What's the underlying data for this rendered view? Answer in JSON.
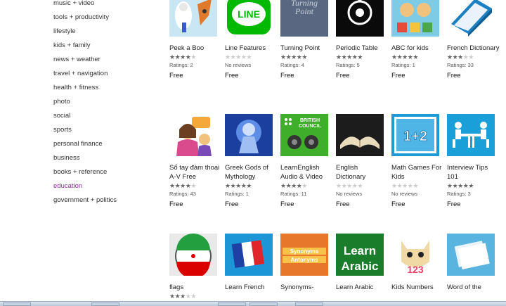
{
  "sidebar": {
    "categories": [
      {
        "label": "music + video"
      },
      {
        "label": "tools + productivity"
      },
      {
        "label": "lifestyle"
      },
      {
        "label": "kids + family"
      },
      {
        "label": "news + weather"
      },
      {
        "label": "travel + navigation"
      },
      {
        "label": "health + fitness"
      },
      {
        "label": "photo"
      },
      {
        "label": "social"
      },
      {
        "label": "sports"
      },
      {
        "label": "personal finance"
      },
      {
        "label": "business"
      },
      {
        "label": "books + reference"
      },
      {
        "label": "education",
        "active": true
      },
      {
        "label": "government + politics"
      }
    ]
  },
  "apps": [
    {
      "name": "Peek a Boo",
      "rating": 4.5,
      "ratings_text": "Ratings: 2",
      "price": "Free",
      "icon": "peekaboo-icon"
    },
    {
      "name": "Line Features",
      "rating": 0,
      "ratings_text": "No reviews",
      "price": "Free",
      "icon": "line-icon",
      "icon_text": "LINE"
    },
    {
      "name": "Turning Point",
      "rating": 5,
      "ratings_text": "Ratings: 4",
      "price": "Free",
      "icon": "turning-point-icon",
      "icon_text": "Turning Point"
    },
    {
      "name": "Periodic Table",
      "rating": 5,
      "ratings_text": "Ratings: 5",
      "price": "Free",
      "icon": "periodic-table-icon"
    },
    {
      "name": "ABC for kids",
      "rating": 5,
      "ratings_text": "Ratings: 1",
      "price": "Free",
      "icon": "abc-kids-icon"
    },
    {
      "name": "French Dictionary",
      "rating": 3,
      "ratings_text": "Ratings: 33",
      "price": "Free",
      "icon": "french-dictionary-icon"
    },
    {
      "name": "Sổ tay đàm thoại A-V Free",
      "rating": 4.5,
      "ratings_text": "Ratings: 43",
      "price": "Free",
      "icon": "so-tay-icon"
    },
    {
      "name": "Greek Gods of Mythology",
      "rating": 5,
      "ratings_text": "Ratings: 1",
      "price": "Free",
      "icon": "greek-gods-icon"
    },
    {
      "name": "LearnEnglish Audio & Video",
      "rating": 4.5,
      "ratings_text": "Ratings: 11",
      "price": "Free",
      "icon": "british-council-icon",
      "icon_text": "BRITISH COUNCIL"
    },
    {
      "name": "English Dictionary",
      "rating": 0,
      "ratings_text": "No reviews",
      "price": "Free",
      "icon": "english-dictionary-icon"
    },
    {
      "name": "Math Games For Kids",
      "rating": 0,
      "ratings_text": "No reviews",
      "price": "Free",
      "icon": "math-games-icon",
      "icon_text": "1+2"
    },
    {
      "name": "Interview Tips 101",
      "rating": 5,
      "ratings_text": "Ratings: 3",
      "price": "Free",
      "icon": "interview-tips-icon"
    },
    {
      "name": "flags",
      "rating": 3,
      "icon": "iran-flag-icon"
    },
    {
      "name": "Learn French",
      "icon": "french-flag-icon"
    },
    {
      "name": "Synonyms-",
      "icon": "synonyms-antonyms-icon",
      "icon_text_1": "Synonyms",
      "icon_text_2": "Antonyms"
    },
    {
      "name": "Learn Arabic",
      "icon": "learn-arabic-icon",
      "icon_text_1": "Learn",
      "icon_text_2": "Arabic"
    },
    {
      "name": "Kids Numbers",
      "icon": "kids-numbers-icon",
      "icon_text": "123"
    },
    {
      "name": "Word of the",
      "icon": "word-of-day-icon"
    }
  ],
  "colors": {
    "active_category": "#8a2d9b",
    "line_green": "#00b900",
    "arabic_green": "#1a7d2b",
    "math_blue": "#1c9ad6",
    "interview_blue": "#1a9fd9"
  }
}
